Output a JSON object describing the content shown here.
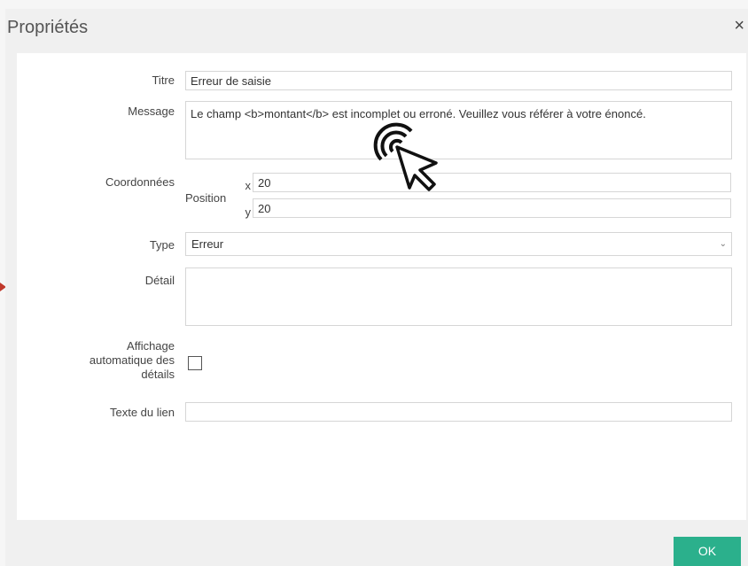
{
  "dialog": {
    "title": "Propriétés",
    "close_glyph": "×"
  },
  "form": {
    "titre": {
      "label": "Titre",
      "value": "Erreur de saisie"
    },
    "message": {
      "label": "Message",
      "value": "Le champ <b>montant</b> est incomplet ou erroné. Veuillez vous référer à votre énoncé."
    },
    "coordonnees": {
      "label": "Coordonnées",
      "position_label": "Position",
      "x_label": "x",
      "x_value": "20",
      "y_label": "y",
      "y_value": "20"
    },
    "type": {
      "label": "Type",
      "value": "Erreur"
    },
    "detail": {
      "label": "Détail",
      "value": ""
    },
    "affichage": {
      "label_line1": "Affichage",
      "label_line2": "automatique des",
      "label_line3": "détails",
      "checked": false
    },
    "texte_lien": {
      "label": "Texte du lien",
      "value": ""
    }
  },
  "footer": {
    "ok_label": "OK"
  },
  "colors": {
    "accent": "#2bb08c",
    "arrow": "#c0392b"
  },
  "icons": {
    "close": "close-icon",
    "chevron": "chevron-down-icon",
    "cursor": "pointer-click-icon"
  }
}
